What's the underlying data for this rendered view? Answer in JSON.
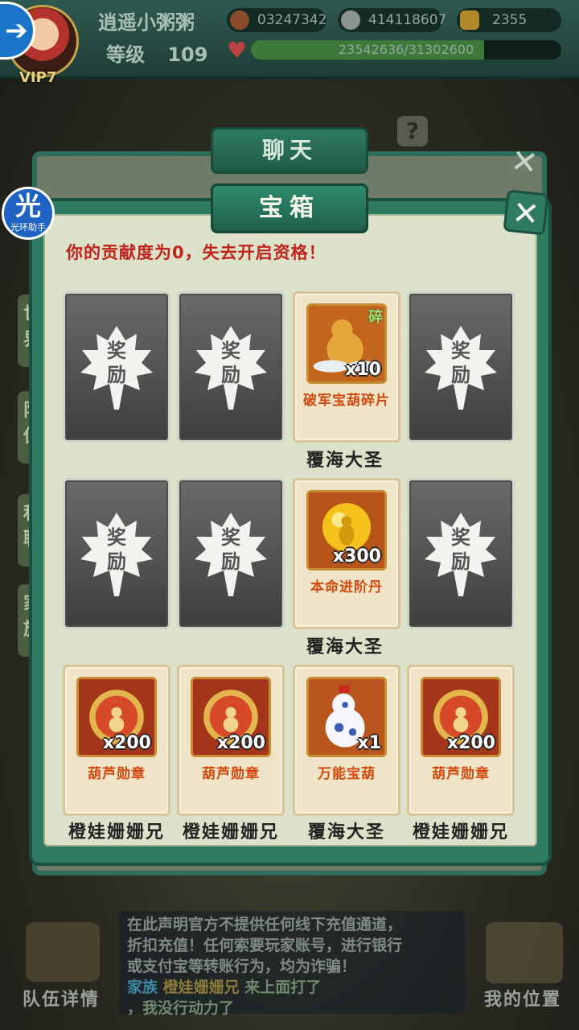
{
  "player": {
    "name": "逍遥小粥粥",
    "level_label": "等级",
    "level": "109",
    "vip": "VIP7"
  },
  "resources": {
    "stamina": "03247342",
    "silver": "414118607",
    "gold": "2355"
  },
  "xp": {
    "text": "23542636/31302600",
    "fraction": 0.752
  },
  "background": {
    "chat_tab": "聊天",
    "side_tabs": [
      "世界",
      "队伍",
      "私聊",
      "家族"
    ],
    "notice_lines": [
      "在此声明官方不提供任何线下充值通道，",
      "折扣充值！任何索要玩家账号，进行银行",
      "或支付宝等转账行为，均为诈骗！"
    ],
    "chat_channel": "家族",
    "chat_sender": "橙娃姗姗兄",
    "chat_msg1": "来上面打了",
    "chat_msg2": "，我没行动力了",
    "team_button": "队伍详情",
    "location_button": "我的位置"
  },
  "helper": {
    "big": "光",
    "small": "光环助手"
  },
  "modal": {
    "title": "宝箱",
    "close": "✕",
    "notice": "你的贡献度为0，失去开启资格！",
    "closed_label": "奖励",
    "rows": [
      {
        "owner": "覆海大圣",
        "cells": [
          {
            "state": "closed"
          },
          {
            "state": "closed"
          },
          {
            "state": "opened",
            "name": "破军宝葫碎片",
            "qty": "x10",
            "badge": "碎",
            "icon": "gourd-fragment-icon"
          },
          {
            "state": "closed"
          }
        ]
      },
      {
        "owner": "覆海大圣",
        "cells": [
          {
            "state": "closed"
          },
          {
            "state": "closed"
          },
          {
            "state": "opened",
            "name": "本命进阶丹",
            "qty": "x300",
            "icon": "golden-pill-icon"
          },
          {
            "state": "closed"
          }
        ]
      },
      {
        "cells": [
          {
            "state": "opened",
            "name": "葫芦勋章",
            "qty": "x200",
            "icon": "gourd-medal-icon",
            "owner": "橙娃姗姗兄"
          },
          {
            "state": "opened",
            "name": "葫芦勋章",
            "qty": "x200",
            "icon": "gourd-medal-icon",
            "owner": "橙娃姗姗兄"
          },
          {
            "state": "opened",
            "name": "万能宝葫",
            "qty": "x1",
            "icon": "porcelain-gourd-icon",
            "owner": "覆海大圣"
          },
          {
            "state": "opened",
            "name": "葫芦勋章",
            "qty": "x200",
            "icon": "gourd-medal-icon",
            "owner": "橙娃姗姗兄"
          }
        ]
      }
    ]
  }
}
